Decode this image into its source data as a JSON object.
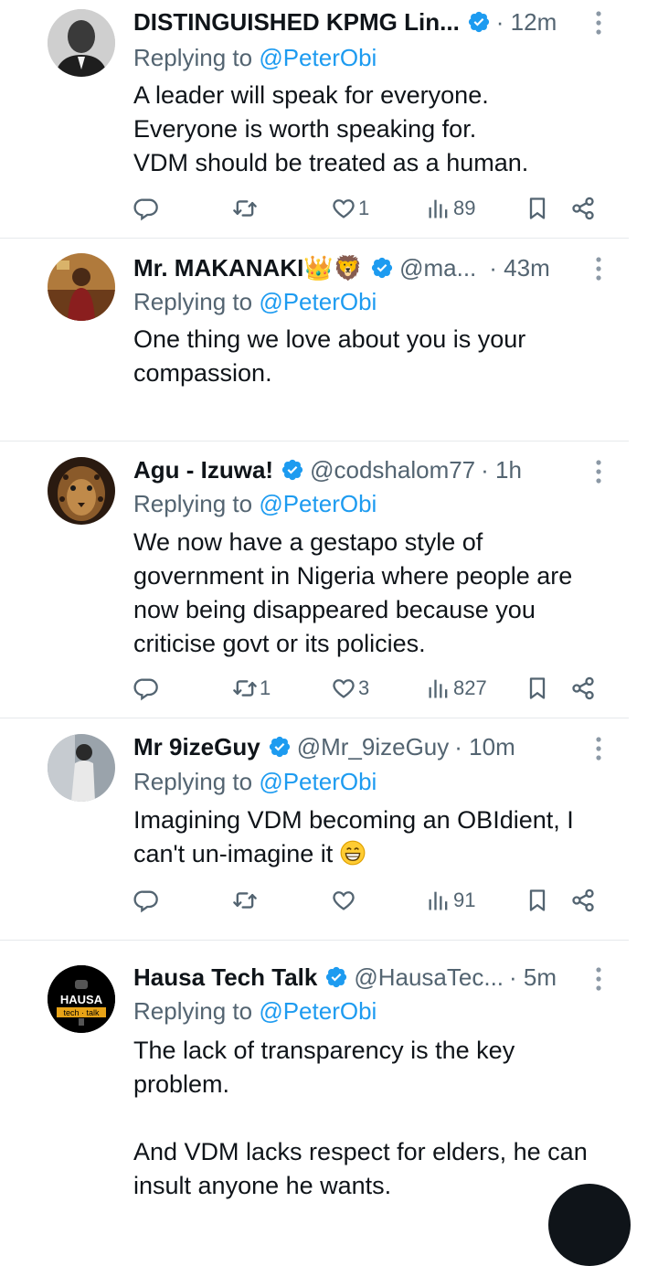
{
  "replies": [
    {
      "name": "DISTINGUISHED KPMG Lin...",
      "handle": "",
      "time": "· 12m",
      "replying_prefix": "Replying to ",
      "replying_to": "@PeterObi",
      "text": "A leader will speak for everyone.\nEveryone is worth speaking for.\nVDM should be treated as a human.",
      "stats": {
        "reply": "",
        "repost": "",
        "like": "1",
        "views": "89"
      }
    },
    {
      "name": "Mr. MAKANAKI👑🦁",
      "handle": "@ma...",
      "time": "· 43m",
      "replying_prefix": "Replying to ",
      "replying_to": "@PeterObi",
      "text": "One thing we love about you is your\ncompassion.",
      "stats": null
    },
    {
      "name": "Agu - Izuwa!",
      "handle": "@codshalom77",
      "time": "· 1h",
      "replying_prefix": "Replying to ",
      "replying_to": "@PeterObi",
      "text": "We now have a gestapo style of\ngovernment in Nigeria where people are\nnow being disappeared because you\ncriticise govt or its policies.",
      "stats": {
        "reply": "",
        "repost": "1",
        "like": "3",
        "views": "827"
      }
    },
    {
      "name": "Mr 9izeGuy",
      "handle": "@Mr_9izeGuy",
      "time": "· 10m",
      "replying_prefix": "Replying to ",
      "replying_to": "@PeterObi",
      "text": "Imagining VDM becoming an OBIdient, I\ncan't un-imagine it",
      "stats": {
        "reply": "",
        "repost": "",
        "like": "",
        "views": "91"
      }
    },
    {
      "name": "Hausa Tech Talk",
      "handle": "@HausaTec...",
      "time": "· 5m",
      "replying_prefix": "Replying to ",
      "replying_to": "@PeterObi",
      "text": "The lack of transparency is the key\nproblem.\n\nAnd VDM lacks respect for elders, he can\ninsult anyone he wants.",
      "stats": null,
      "avatar_text": {
        "top": "HAUSA",
        "bottom": "tech · talk"
      }
    }
  ],
  "colors": {
    "accent": "#1d9bf0",
    "secondary_text": "#536471",
    "primary_text": "#0f1419",
    "divider": "#e6e9ec"
  },
  "icons": [
    "verified-badge-icon",
    "more-options-icon",
    "reply-icon",
    "repost-icon",
    "like-icon",
    "views-icon",
    "bookmark-icon",
    "share-icon"
  ]
}
